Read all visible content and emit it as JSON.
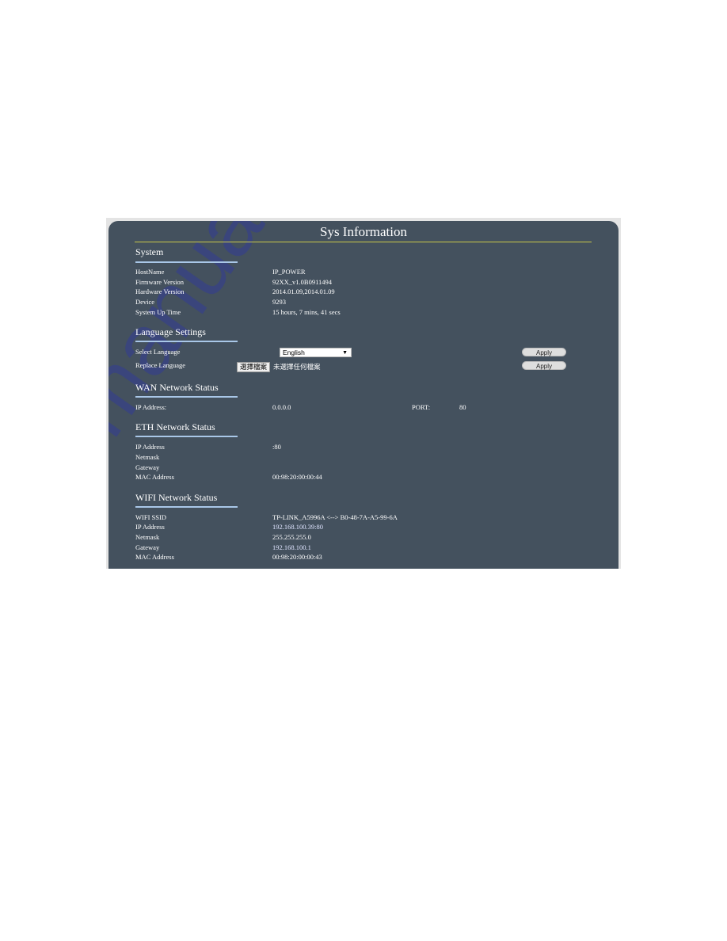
{
  "page": {
    "title": "Sys Information",
    "watermark": "manualshive.com"
  },
  "system": {
    "heading": "System",
    "rows": [
      {
        "label": "HostName",
        "value": "IP_POWER"
      },
      {
        "label": "Firmware Version",
        "value": "92XX_v1.0B0911494"
      },
      {
        "label": "Hardware Version",
        "value": "2014.01.09,2014.01.09"
      },
      {
        "label": "Device",
        "value": "9293"
      },
      {
        "label": "System Up Time",
        "value": "15 hours, 7 mins, 41 secs"
      }
    ]
  },
  "language": {
    "heading": "Language Settings",
    "select_label": "Select Language",
    "select_value": "English",
    "replace_label": "Replace Language",
    "file_button": "選擇檔案",
    "file_status": "未選擇任何檔案",
    "apply1": "Apply",
    "apply2": "Apply"
  },
  "wan": {
    "heading": "WAN Network Status",
    "ip_label": "IP Address:",
    "ip_value": "0.0.0.0",
    "port_label": "PORT:",
    "port_value": "80"
  },
  "eth": {
    "heading": "ETH Network Status",
    "rows": [
      {
        "label": "IP Address",
        "value": ":80"
      },
      {
        "label": "Netmask",
        "value": ""
      },
      {
        "label": "Gateway",
        "value": ""
      },
      {
        "label": "MAC Address",
        "value": "00:98:20:00:00:44"
      }
    ]
  },
  "wifi": {
    "heading": "WIFI Network Status",
    "rows": [
      {
        "label": "WIFI SSID",
        "value": "TP-LINK_A5996A <--> B0-48-7A-A5-99-6A"
      },
      {
        "label": "IP Address",
        "value": "192.168.100.39:80"
      },
      {
        "label": "Netmask",
        "value": "255.255.255.0"
      },
      {
        "label": "Gateway",
        "value": "192.168.100.1"
      },
      {
        "label": "MAC Address",
        "value": "00:98:20:00:00:43"
      }
    ]
  }
}
